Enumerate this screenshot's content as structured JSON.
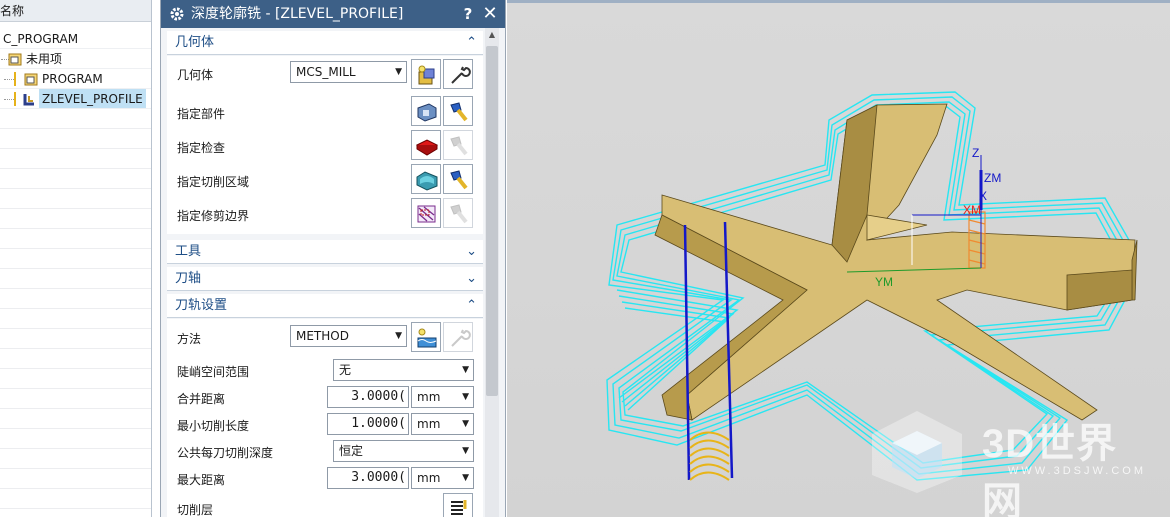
{
  "navigator": {
    "header": "名称",
    "items": [
      {
        "label": "C_PROGRAM"
      },
      {
        "label": "未用项"
      },
      {
        "label": "PROGRAM"
      },
      {
        "label": "ZLEVEL_PROFILE"
      }
    ]
  },
  "dialog": {
    "title": "深度轮廓铣 - [ZLEVEL_PROFILE]",
    "help": "?",
    "close": "✕",
    "sections": {
      "geometry": {
        "title": "几何体",
        "geometry_label": "几何体",
        "geometry_value": "MCS_MILL",
        "specify_part": "指定部件",
        "specify_check": "指定检查",
        "specify_cut_area": "指定切削区域",
        "specify_trim": "指定修剪边界"
      },
      "tool": {
        "title": "工具"
      },
      "axis": {
        "title": "刀轴"
      },
      "path": {
        "title": "刀轨设置",
        "method_label": "方法",
        "method_value": "METHOD",
        "steep_label": "陡峭空间范围",
        "steep_value": "无",
        "merge_label": "合并距离",
        "merge_value": "3.0000(",
        "merge_unit": "mm",
        "min_cut_label": "最小切削长度",
        "min_cut_value": "1.0000(",
        "min_cut_unit": "mm",
        "depth_label": "公共每刀切削深度",
        "depth_value": "恒定",
        "max_dist_label": "最大距离",
        "max_dist_value": "3.0000(",
        "max_dist_unit": "mm",
        "levels_label": "切削层"
      }
    }
  },
  "viewport": {
    "axis_z": "Z",
    "axis_zm": "ZM",
    "axis_x": "X",
    "axis_xm": "XM",
    "axis_ym": "YM",
    "watermark_title": "3D世界网",
    "watermark_url": "WWW.3DSJW.COM"
  },
  "colors": {
    "title_bar": "#3d6087",
    "section_text": "#1e4e86",
    "toolpath": "#27e6f2",
    "part": "#d8be74",
    "viewport_bg": "#d6d6d6"
  }
}
